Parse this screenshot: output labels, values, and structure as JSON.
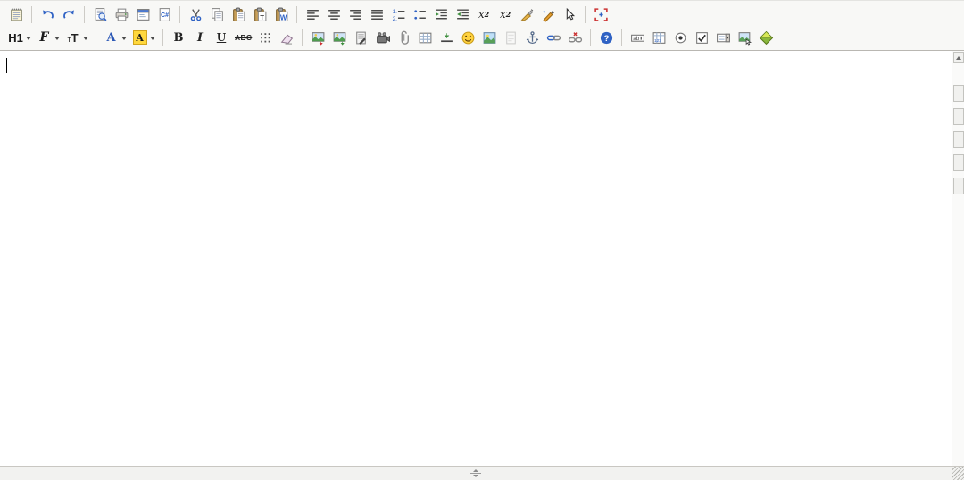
{
  "colors": {
    "toolbar_bg": "#f8f8f6",
    "separator": "#cdcbc6",
    "accent_blue": "#2f62c4",
    "highlight_yellow": "#ffd83d",
    "maximize_red": "#cc3333",
    "smiley_yellow": "#ffd23e",
    "diamond_green": "#8ab83c"
  },
  "toolbar": {
    "row1": {
      "groups": [
        {
          "items": [
            {
              "name": "new-document-button",
              "icon": "notepad-icon",
              "kind": "notepad"
            }
          ]
        },
        {
          "items": [
            {
              "name": "undo-button",
              "icon": "undo-icon",
              "kind": "undo"
            },
            {
              "name": "redo-button",
              "icon": "redo-icon",
              "kind": "redo"
            }
          ]
        },
        {
          "items": [
            {
              "name": "preview-button",
              "icon": "preview-icon",
              "kind": "preview"
            },
            {
              "name": "print-button",
              "icon": "printer-icon",
              "kind": "print"
            },
            {
              "name": "templates-button",
              "icon": "window-icon",
              "kind": "window"
            },
            {
              "name": "document-properties-button",
              "icon": "document-code-icon",
              "kind": "doccode"
            }
          ]
        },
        {
          "items": [
            {
              "name": "cut-button",
              "icon": "scissors-icon",
              "kind": "cut"
            },
            {
              "name": "copy-button",
              "icon": "copy-icon",
              "kind": "copy"
            },
            {
              "name": "paste-button",
              "icon": "paste-icon",
              "kind": "paste"
            },
            {
              "name": "paste-as-text-button",
              "icon": "paste-text-icon",
              "kind": "paste2"
            },
            {
              "name": "paste-from-word-button",
              "icon": "paste-word-icon",
              "kind": "paste3"
            }
          ]
        },
        {
          "items": [
            {
              "name": "align-left-button",
              "icon": "align-left-icon",
              "kind": "al"
            },
            {
              "name": "align-center-button",
              "icon": "align-center-icon",
              "kind": "ac"
            },
            {
              "name": "align-right-button",
              "icon": "align-right-icon",
              "kind": "ar"
            },
            {
              "name": "justify-button",
              "icon": "justify-icon",
              "kind": "aj"
            },
            {
              "name": "ordered-list-button",
              "icon": "ordered-list-icon",
              "kind": "ol"
            },
            {
              "name": "unordered-list-button",
              "icon": "unordered-list-icon",
              "kind": "ul"
            },
            {
              "name": "indent-button",
              "icon": "indent-icon",
              "kind": "indent"
            },
            {
              "name": "outdent-button",
              "icon": "outdent-icon",
              "kind": "outdent"
            },
            {
              "name": "subscript-button",
              "icon": "subscript-icon",
              "kind": "sub",
              "label": "x",
              "script": "2"
            },
            {
              "name": "superscript-button",
              "icon": "superscript-icon",
              "kind": "sup",
              "label": "x",
              "script": "2"
            },
            {
              "name": "color-dropper-button",
              "icon": "dropper-icon",
              "kind": "dropper"
            },
            {
              "name": "spell-check-button",
              "icon": "magic-pen-icon",
              "kind": "pen"
            },
            {
              "name": "select-cursor-button",
              "icon": "cursor-icon",
              "kind": "cursor"
            }
          ]
        },
        {
          "items": [
            {
              "name": "maximize-button",
              "icon": "maximize-icon",
              "kind": "maximize"
            }
          ]
        }
      ]
    },
    "row2": {
      "groups": [
        {
          "items": [
            {
              "name": "heading-select",
              "icon": "heading-icon",
              "kind": "h1",
              "label": "H1",
              "dropdown": true
            },
            {
              "name": "font-select",
              "icon": "font-icon",
              "kind": "font",
              "label": "F",
              "dropdown": true
            },
            {
              "name": "font-size-select",
              "icon": "font-size-icon",
              "kind": "tt",
              "label_small": "т",
              "label_big": "T",
              "dropdown": true
            }
          ]
        },
        {
          "items": [
            {
              "name": "text-color-button",
              "icon": "text-color-icon",
              "kind": "colorA",
              "label": "A",
              "dropdown": true
            },
            {
              "name": "highlight-color-button",
              "icon": "highlight-color-icon",
              "kind": "hlA",
              "label": "A",
              "dropdown": true
            }
          ]
        },
        {
          "items": [
            {
              "name": "bold-button",
              "icon": "bold-icon",
              "kind": "b",
              "label": "B"
            },
            {
              "name": "italic-button",
              "icon": "italic-icon",
              "kind": "i",
              "label": "I"
            },
            {
              "name": "underline-button",
              "icon": "underline-icon",
              "kind": "u",
              "label": "U"
            },
            {
              "name": "strikethrough-button",
              "icon": "strikethrough-icon",
              "kind": "s",
              "label": "ABC"
            },
            {
              "name": "special-characters-button",
              "icon": "character-grid-icon",
              "kind": "griddots"
            },
            {
              "name": "remove-format-button",
              "icon": "eraser-icon",
              "kind": "eraser"
            }
          ]
        },
        {
          "items": [
            {
              "name": "insert-image-button",
              "icon": "insert-image-icon",
              "kind": "img1"
            },
            {
              "name": "upload-image-button",
              "icon": "image-upload-icon",
              "kind": "img2"
            },
            {
              "name": "insert-media-button",
              "icon": "media-document-icon",
              "kind": "docdark"
            },
            {
              "name": "insert-video-button",
              "icon": "video-camera-icon",
              "kind": "video"
            },
            {
              "name": "attach-file-button",
              "icon": "paperclip-icon",
              "kind": "clip"
            },
            {
              "name": "insert-table-button",
              "icon": "table-icon",
              "kind": "table"
            },
            {
              "name": "insert-rule-button",
              "icon": "horizontal-rule-icon",
              "kind": "hr"
            },
            {
              "name": "insert-emoticon-button",
              "icon": "smiley-icon",
              "kind": "smiley"
            },
            {
              "name": "insert-picture-button",
              "icon": "picture-icon",
              "kind": "pic"
            },
            {
              "name": "page-break-button",
              "icon": "page-break-icon",
              "kind": "pagegray"
            },
            {
              "name": "insert-anchor-button",
              "icon": "anchor-icon",
              "kind": "anchor"
            },
            {
              "name": "insert-link-button",
              "icon": "link-icon",
              "kind": "link"
            },
            {
              "name": "remove-link-button",
              "icon": "unlink-icon",
              "kind": "unlink"
            }
          ]
        },
        {
          "items": [
            {
              "name": "help-button",
              "icon": "help-icon",
              "kind": "help"
            }
          ]
        },
        {
          "items": [
            {
              "name": "form-textfield-button",
              "icon": "text-field-icon",
              "kind": "tfield"
            },
            {
              "name": "form-textarea-button",
              "icon": "textarea-grid-icon",
              "kind": "tarea"
            },
            {
              "name": "form-radio-button",
              "icon": "radio-icon",
              "kind": "radio"
            },
            {
              "name": "form-checkbox-button",
              "icon": "checkbox-icon",
              "kind": "check"
            },
            {
              "name": "form-select-button",
              "icon": "select-field-icon",
              "kind": "select"
            },
            {
              "name": "form-image-button",
              "icon": "image-button-icon",
              "kind": "imgbtn"
            },
            {
              "name": "form-submit-button",
              "icon": "diamond-icon",
              "kind": "diamond"
            }
          ]
        }
      ]
    }
  },
  "editor": {
    "content": "",
    "caret_visible": true
  },
  "right_rail": {
    "buttons": [
      {
        "name": "scroll-up-button",
        "type": "arrow"
      },
      {
        "name": "side-rail-button-1",
        "type": "box"
      },
      {
        "name": "side-rail-button-2",
        "type": "box"
      },
      {
        "name": "side-rail-button-3",
        "type": "box"
      },
      {
        "name": "side-rail-button-4",
        "type": "box"
      },
      {
        "name": "side-rail-button-5",
        "type": "box"
      }
    ]
  },
  "bottom_bar": {
    "resize_handle": "drag-to-resize"
  }
}
